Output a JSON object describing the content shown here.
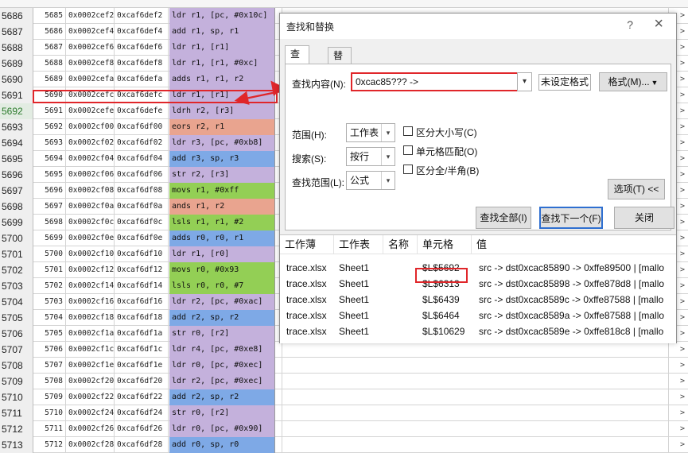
{
  "sheet": {
    "rows": [
      {
        "hdr": "5686",
        "a": "5685",
        "b": "0x0002cef2",
        "c": "0xcaf6def2",
        "d": "ldr r1, [pc, #0x10c]",
        "color": "#c4b1dc",
        "sel": false
      },
      {
        "hdr": "5687",
        "a": "5686",
        "b": "0x0002cef4",
        "c": "0xcaf6def4",
        "d": "add r1, sp, r1",
        "color": "#c4b1dc",
        "sel": false
      },
      {
        "hdr": "5688",
        "a": "5687",
        "b": "0x0002cef6",
        "c": "0xcaf6def6",
        "d": "ldr r1, [r1]",
        "color": "#c4b1dc",
        "sel": false
      },
      {
        "hdr": "5689",
        "a": "5688",
        "b": "0x0002cef8",
        "c": "0xcaf6def8",
        "d": "ldr r1, [r1, #0xc]",
        "color": "#c4b1dc",
        "sel": false
      },
      {
        "hdr": "5690",
        "a": "5689",
        "b": "0x0002cefa",
        "c": "0xcaf6defa",
        "d": "adds r1, r1, r2",
        "color": "#c4b1dc",
        "sel": false
      },
      {
        "hdr": "5691",
        "a": "5690",
        "b": "0x0002cefc",
        "c": "0xcaf6defc",
        "d": "ldr r1, [r1]",
        "color": "#c4b1dc",
        "sel": false
      },
      {
        "hdr": "5692",
        "a": "5691",
        "b": "0x0002cefe",
        "c": "0xcaf6defe",
        "d": "ldrh r2, [r3]",
        "color": "#c4b1dc",
        "sel": true
      },
      {
        "hdr": "5693",
        "a": "5692",
        "b": "0x0002cf00",
        "c": "0xcaf6df00",
        "d": "eors r2, r1",
        "color": "#e9a48f",
        "sel": false
      },
      {
        "hdr": "5694",
        "a": "5693",
        "b": "0x0002cf02",
        "c": "0xcaf6df02",
        "d": "ldr r3, [pc, #0xb8]",
        "color": "#c4b1dc",
        "sel": false
      },
      {
        "hdr": "5695",
        "a": "5694",
        "b": "0x0002cf04",
        "c": "0xcaf6df04",
        "d": "add r3, sp, r3",
        "color": "#7ea9e6",
        "sel": false
      },
      {
        "hdr": "5696",
        "a": "5695",
        "b": "0x0002cf06",
        "c": "0xcaf6df06",
        "d": "str r2, [r3]",
        "color": "#c4b1dc",
        "sel": false
      },
      {
        "hdr": "5697",
        "a": "5696",
        "b": "0x0002cf08",
        "c": "0xcaf6df08",
        "d": "movs r1, #0xff",
        "color": "#93cf55",
        "sel": false
      },
      {
        "hdr": "5698",
        "a": "5697",
        "b": "0x0002cf0a",
        "c": "0xcaf6df0a",
        "d": "ands r1, r2",
        "color": "#e9a48f",
        "sel": false
      },
      {
        "hdr": "5699",
        "a": "5698",
        "b": "0x0002cf0c",
        "c": "0xcaf6df0c",
        "d": "lsls r1, r1, #2",
        "color": "#93cf55",
        "sel": false
      },
      {
        "hdr": "5700",
        "a": "5699",
        "b": "0x0002cf0e",
        "c": "0xcaf6df0e",
        "d": "adds r0, r0, r1",
        "color": "#7ea9e6",
        "sel": false
      },
      {
        "hdr": "5701",
        "a": "5700",
        "b": "0x0002cf10",
        "c": "0xcaf6df10",
        "d": "ldr r1, [r0]",
        "color": "#c4b1dc",
        "sel": false
      },
      {
        "hdr": "5702",
        "a": "5701",
        "b": "0x0002cf12",
        "c": "0xcaf6df12",
        "d": "movs r0, #0x93",
        "color": "#93cf55",
        "sel": false
      },
      {
        "hdr": "5703",
        "a": "5702",
        "b": "0x0002cf14",
        "c": "0xcaf6df14",
        "d": "lsls r0, r0, #7",
        "color": "#93cf55",
        "sel": false
      },
      {
        "hdr": "5704",
        "a": "5703",
        "b": "0x0002cf16",
        "c": "0xcaf6df16",
        "d": "ldr r2, [pc, #0xac]",
        "color": "#c4b1dc",
        "sel": false
      },
      {
        "hdr": "5705",
        "a": "5704",
        "b": "0x0002cf18",
        "c": "0xcaf6df18",
        "d": "add r2, sp, r2",
        "color": "#7ea9e6",
        "sel": false
      },
      {
        "hdr": "5706",
        "a": "5705",
        "b": "0x0002cf1a",
        "c": "0xcaf6df1a",
        "d": "str r0, [r2]",
        "color": "#c4b1dc",
        "sel": false
      },
      {
        "hdr": "5707",
        "a": "5706",
        "b": "0x0002cf1c",
        "c": "0xcaf6df1c",
        "d": "ldr r4, [pc, #0xe8]",
        "color": "#c4b1dc",
        "sel": false
      },
      {
        "hdr": "5708",
        "a": "5707",
        "b": "0x0002cf1e",
        "c": "0xcaf6df1e",
        "d": "ldr r0, [pc, #0xec]",
        "color": "#c4b1dc",
        "sel": false
      },
      {
        "hdr": "5709",
        "a": "5708",
        "b": "0x0002cf20",
        "c": "0xcaf6df20",
        "d": "ldr r2, [pc, #0xec]",
        "color": "#c4b1dc",
        "sel": false
      },
      {
        "hdr": "5710",
        "a": "5709",
        "b": "0x0002cf22",
        "c": "0xcaf6df22",
        "d": "add r2, sp, r2",
        "color": "#7ea9e6",
        "sel": false
      },
      {
        "hdr": "5711",
        "a": "5710",
        "b": "0x0002cf24",
        "c": "0xcaf6df24",
        "d": "str r0, [r2]",
        "color": "#c4b1dc",
        "sel": false
      },
      {
        "hdr": "5712",
        "a": "5711",
        "b": "0x0002cf26",
        "c": "0xcaf6df26",
        "d": "ldr r0, [pc, #0x90]",
        "color": "#c4b1dc",
        "sel": false
      },
      {
        "hdr": "5713",
        "a": "5712",
        "b": "0x0002cf28",
        "c": "0xcaf6df28",
        "d": "add r0, sp, r0",
        "color": "#7ea9e6",
        "sel": false
      }
    ]
  },
  "dialog": {
    "title": "查找和替换",
    "help": "?",
    "close": "×",
    "tabs": {
      "find": "查找(D)",
      "replace": "替换(P)"
    },
    "find_label": "查找内容(N):",
    "find_value": "0xcac85??? ->",
    "no_format": "未设定格式",
    "format_btn": "格式(M)...",
    "within_label": "范围(H):",
    "within_value": "工作表",
    "search_label": "搜索(S):",
    "search_value": "按行",
    "lookin_label": "查找范围(L):",
    "lookin_value": "公式",
    "match_case": "区分大小写(C)",
    "match_entire": "单元格匹配(O)",
    "match_width": "区分全/半角(B)",
    "options_btn": "选项(T) <<",
    "find_all": "查找全部(I)",
    "find_next": "查找下一个(F)",
    "close_btn": "关闭"
  },
  "results": {
    "headers": {
      "book": "工作薄",
      "sheet": "工作表",
      "name": "名称",
      "cell": "单元格",
      "value": "值"
    },
    "rows": [
      {
        "book": "trace.xlsx",
        "sheet": "Sheet1",
        "cell": "$L$5692",
        "value": "src -> dst0xcac85890 -> 0xffe89500 | [mallo"
      },
      {
        "book": "trace.xlsx",
        "sheet": "Sheet1",
        "cell": "$L$6313",
        "value": "src -> dst0xcac85898 -> 0xffe878d8 | [mallo"
      },
      {
        "book": "trace.xlsx",
        "sheet": "Sheet1",
        "cell": "$L$6439",
        "value": "src -> dst0xcac8589c -> 0xffe87588 | [mallo"
      },
      {
        "book": "trace.xlsx",
        "sheet": "Sheet1",
        "cell": "$L$6464",
        "value": "src -> dst0xcac8589a -> 0xffe87588 | [mallo"
      },
      {
        "book": "trace.xlsx",
        "sheet": "Sheet1",
        "cell": "$L$10629",
        "value": "src -> dst0xcac8589e -> 0xffe818c8 | [mallo"
      }
    ]
  },
  "colors": {
    "annotation": "#e0262a",
    "focus": "#2f6fd0"
  }
}
